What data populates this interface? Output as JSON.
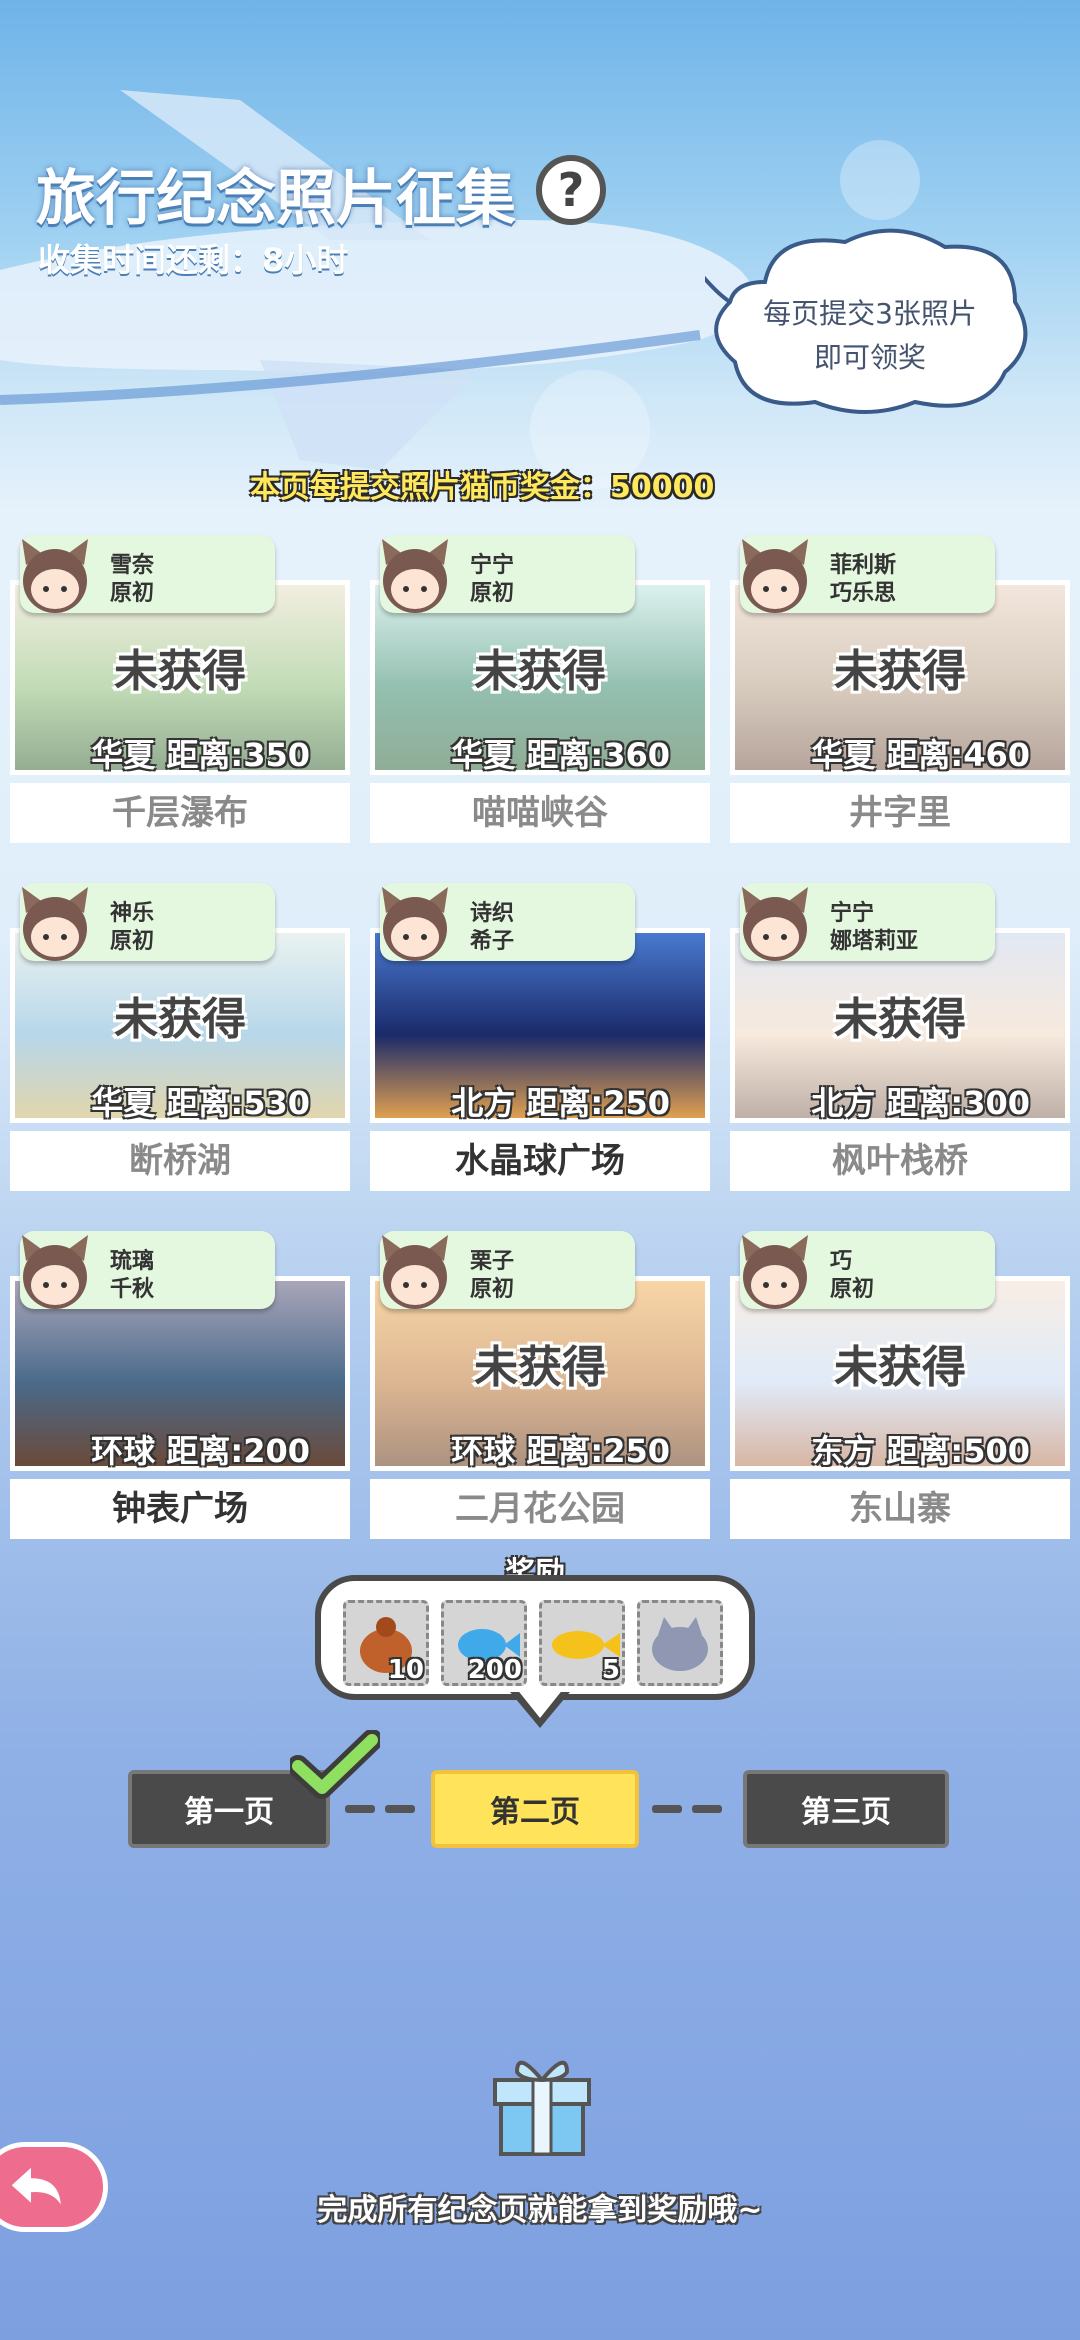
{
  "header": {
    "title": "旅行纪念照片征集",
    "help_icon": "?",
    "timer": "收集时间还剩：8小时",
    "bubble_line1": "每页提交3张照片",
    "bubble_line2": "即可领奖",
    "bonus": "本页每提交照片猫币奖金：50000"
  },
  "cards": [
    {
      "char1": "雪奈",
      "char2": "原初",
      "status": "未获得",
      "dist": "华夏  距离:350",
      "name": "千层瀑布",
      "obtained": false
    },
    {
      "char1": "宁宁",
      "char2": "原初",
      "status": "未获得",
      "dist": "华夏  距离:360",
      "name": "喵喵峡谷",
      "obtained": false
    },
    {
      "char1": "菲利斯",
      "char2": "巧乐思",
      "status": "未获得",
      "dist": "华夏  距离:460",
      "name": "井字里",
      "obtained": false
    },
    {
      "char1": "神乐",
      "char2": "原初",
      "status": "未获得",
      "dist": "华夏  距离:530",
      "name": "断桥湖",
      "obtained": false
    },
    {
      "char1": "诗织",
      "char2": "希子",
      "status": "",
      "dist": "北方  距离:250",
      "name": "水晶球广场",
      "obtained": true
    },
    {
      "char1": "宁宁",
      "char2": "娜塔莉亚",
      "status": "未获得",
      "dist": "北方  距离:300",
      "name": "枫叶栈桥",
      "obtained": false
    },
    {
      "char1": "琉璃",
      "char2": "千秋",
      "status": "",
      "dist": "环球  距离:200",
      "name": "钟表广场",
      "obtained": true
    },
    {
      "char1": "栗子",
      "char2": "原初",
      "status": "未获得",
      "dist": "环球  距离:250",
      "name": "二月花公园",
      "obtained": false
    },
    {
      "char1": "巧",
      "char2": "原初",
      "status": "未获得",
      "dist": "东方  距离:500",
      "name": "东山寨",
      "obtained": false
    }
  ],
  "reward": {
    "label": "奖励",
    "items": [
      {
        "icon": "bag-icon",
        "count": "10"
      },
      {
        "icon": "blue-fish-icon",
        "count": "200"
      },
      {
        "icon": "gold-fish-icon",
        "count": "5"
      },
      {
        "icon": "cat-plush-icon",
        "count": ""
      }
    ]
  },
  "pager": {
    "page1": "第一页",
    "page2": "第二页",
    "page3": "第三页",
    "current": 2,
    "page1_done": true
  },
  "footer": {
    "hint": "完成所有纪念页就能拿到奖励哦~"
  },
  "colors": {
    "accent_yellow": "#ffe35a",
    "tag_green": "#e4f7df",
    "back_pink": "#ee6c8d"
  }
}
